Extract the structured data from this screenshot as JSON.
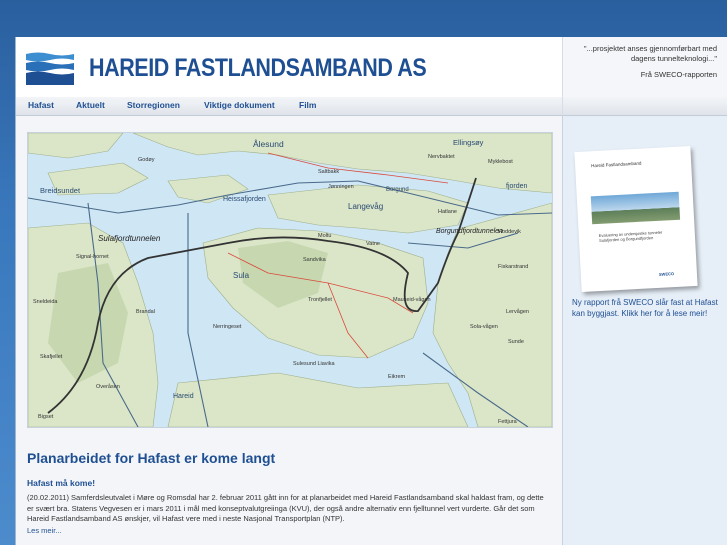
{
  "header": {
    "site_title": "HAREID FASTLANDSAMBAND AS",
    "quote": "\"...prosjektet anses gjennomførbart med dagens tunnelteknologi...\"",
    "quote_source": "Frå SWECO-rapporten"
  },
  "nav": {
    "items": [
      {
        "label": "Hafast"
      },
      {
        "label": "Aktuelt"
      },
      {
        "label": "Storregionen"
      },
      {
        "label": "Viktige dokument"
      },
      {
        "label": "Film"
      }
    ]
  },
  "map": {
    "labels": {
      "alesund": "Ålesund",
      "ellingsoy": "Ellingsøy",
      "breidsundet": "Breidsundet",
      "heissafjorden": "Heissafjorden",
      "langevag": "Langevåg",
      "borgund": "Borgund",
      "sula": "Sula",
      "hareid": "Hareid",
      "sulafjordtunnelen": "Sulafjordtunnelen",
      "borgundfjordtunnelen": "Borgundfjordtunnelen",
      "signalhornet": "Signal-hornet",
      "sneldeida": "Sneldeida",
      "skafjellet": "Skafjellet",
      "overaasen": "Overåsen",
      "brandal": "Brandal",
      "bigset": "Bigset",
      "eikrem": "Eikrem",
      "sunde": "Sunde",
      "solavagen": "Sola-vågen",
      "saltbakk": "Saltbakk",
      "myklebost": "Myklebost",
      "fjorden": "fjorden",
      "moltu": "Moltu",
      "godoy": "Godøy",
      "vatne": "Vatne",
      "sandvika": "Sandvika",
      "mauseidvagen": "Mauseid-vågen",
      "lervagen": "Lervågen",
      "fiskarstrand": "Fiskarstrand",
      "tronfjellet": "Tronfjellet",
      "nerringeset": "Nerringeset",
      "jonningen": "Jønningen",
      "nervbaktet": "Nervbaktet",
      "hatlane": "Hatlane",
      "fettjura": "Fettjura",
      "hoddevik": "Hoddevik",
      "sulesund": "Sulesund Liavika"
    }
  },
  "article": {
    "title": "Planarbeidet for Hafast er kome langt",
    "subtitle": "Hafast må kome!",
    "body": "(20.02.2011) Samferdsleutvalet i Møre og Romsdal har 2. februar 2011 gått inn for at planarbeidet med Hareid Fastlandsamband skal haldast fram, og dette er svært bra. Statens Vegvesen er i mars 2011 i mål med konseptvalutgreiinga (KVU), der også andre alternativ enn fjelltunnel vert vurderte. Går det som Hareid Fastlandsamband AS ønskjer, vil Hafast vere med i neste Nasjonal Transportplan (NTP).",
    "read_more": "Les meir..."
  },
  "sidebar": {
    "report_title": "Hareid Fastlandsamband",
    "report_subtitle": "Evaluering av undersjøiske tunneler Sulafjorden og Borgundfjorden",
    "report_footer": "SWECO",
    "text": "Ny rapport frå SWECO slår fast at Hafast kan byggjast. Klikk her for å lese meir!"
  },
  "colors": {
    "brand_blue": "#1f4f93",
    "background_blue": "#3a78bd",
    "sea": "#cfe6f4",
    "land": "#dbe6c9"
  }
}
